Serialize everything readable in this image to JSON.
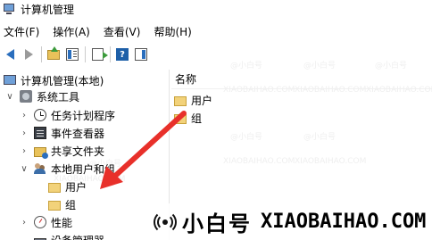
{
  "window": {
    "title": "计算机管理"
  },
  "menu": [
    {
      "label": "文件(F)"
    },
    {
      "label": "操作(A)"
    },
    {
      "label": "查看(V)"
    },
    {
      "label": "帮助(H)"
    }
  ],
  "toolbar": {
    "help_glyph": "?"
  },
  "tree": {
    "root": "计算机管理(本地)",
    "system_tools": "系统工具",
    "task_scheduler": "任务计划程序",
    "event_viewer": "事件查看器",
    "shared_folders": "共享文件夹",
    "local_users_groups": "本地用户和组",
    "users": "用户",
    "groups": "组",
    "performance": "性能",
    "device_manager": "设备管理器"
  },
  "list": {
    "column_name": "名称",
    "items": [
      "用户",
      "组"
    ]
  },
  "watermark": {
    "handle": "@小白号",
    "site": "XIAOBAIHAO.COM"
  },
  "brand": {
    "name_zh": "小白号",
    "site": "XIAOBAIHAO.COM"
  },
  "annotation": {
    "color": "#e8302a"
  }
}
